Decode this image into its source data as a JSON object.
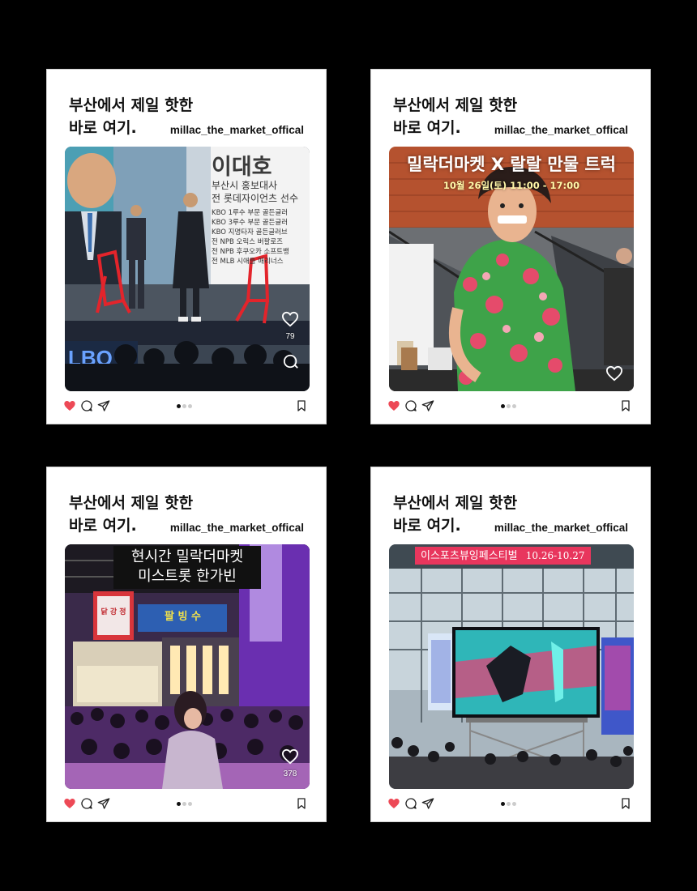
{
  "posts": [
    {
      "headline_line1": "부산에서 제일 핫한",
      "headline_line2": "바로 여기.",
      "account": "millac_the_market_offical",
      "overlay": {
        "name": "이대호",
        "lines": [
          "부산시 홍보대사",
          "전 롯데자이언츠 선수",
          "KBO 1루수 부문 골든글러",
          "KBO 3루수 부문 골든글러",
          "KBO 지명타자 골든글러브",
          "전 NPB 오릭스 버팔로즈",
          "전 NPB 후쿠오카 소프트뱅",
          "전 MLB 시애틀 매리너스"
        ],
        "screen_text": "LBO"
      },
      "likes": "79",
      "liked": true
    },
    {
      "headline_line1": "부산에서 제일 핫한",
      "headline_line2": "바로 여기.",
      "account": "millac_the_market_offical",
      "overlay": {
        "title": "밀락더마켓 X 랄랄 만물 트럭",
        "subtitle": "10월 26일(토) 11:00 - 17:00"
      },
      "liked": true
    },
    {
      "headline_line1": "부산에서 제일 핫한",
      "headline_line2": "바로 여기.",
      "account": "millac_the_market_offical",
      "overlay": {
        "line1": "현시간 밀락더마켓",
        "line2": "미스트롯 한가빈",
        "sign1": "팔 빙 수",
        "sign2": "닭 강 정"
      },
      "likes": "378",
      "liked": true
    },
    {
      "headline_line1": "부산에서 제일 핫한",
      "headline_line2": "바로 여기.",
      "account": "millac_the_market_offical",
      "overlay": {
        "title": "이스포츠뷰잉페스티벌",
        "dates": "10.26-10.27"
      },
      "liked": true
    }
  ],
  "icons": {
    "heart": "heart-icon",
    "comment": "comment-icon",
    "share": "share-icon",
    "save": "bookmark-icon"
  },
  "colors": {
    "heart_red": "#ed4956",
    "background": "#000000",
    "card": "#ffffff",
    "pink_banner": "#e8365d"
  }
}
